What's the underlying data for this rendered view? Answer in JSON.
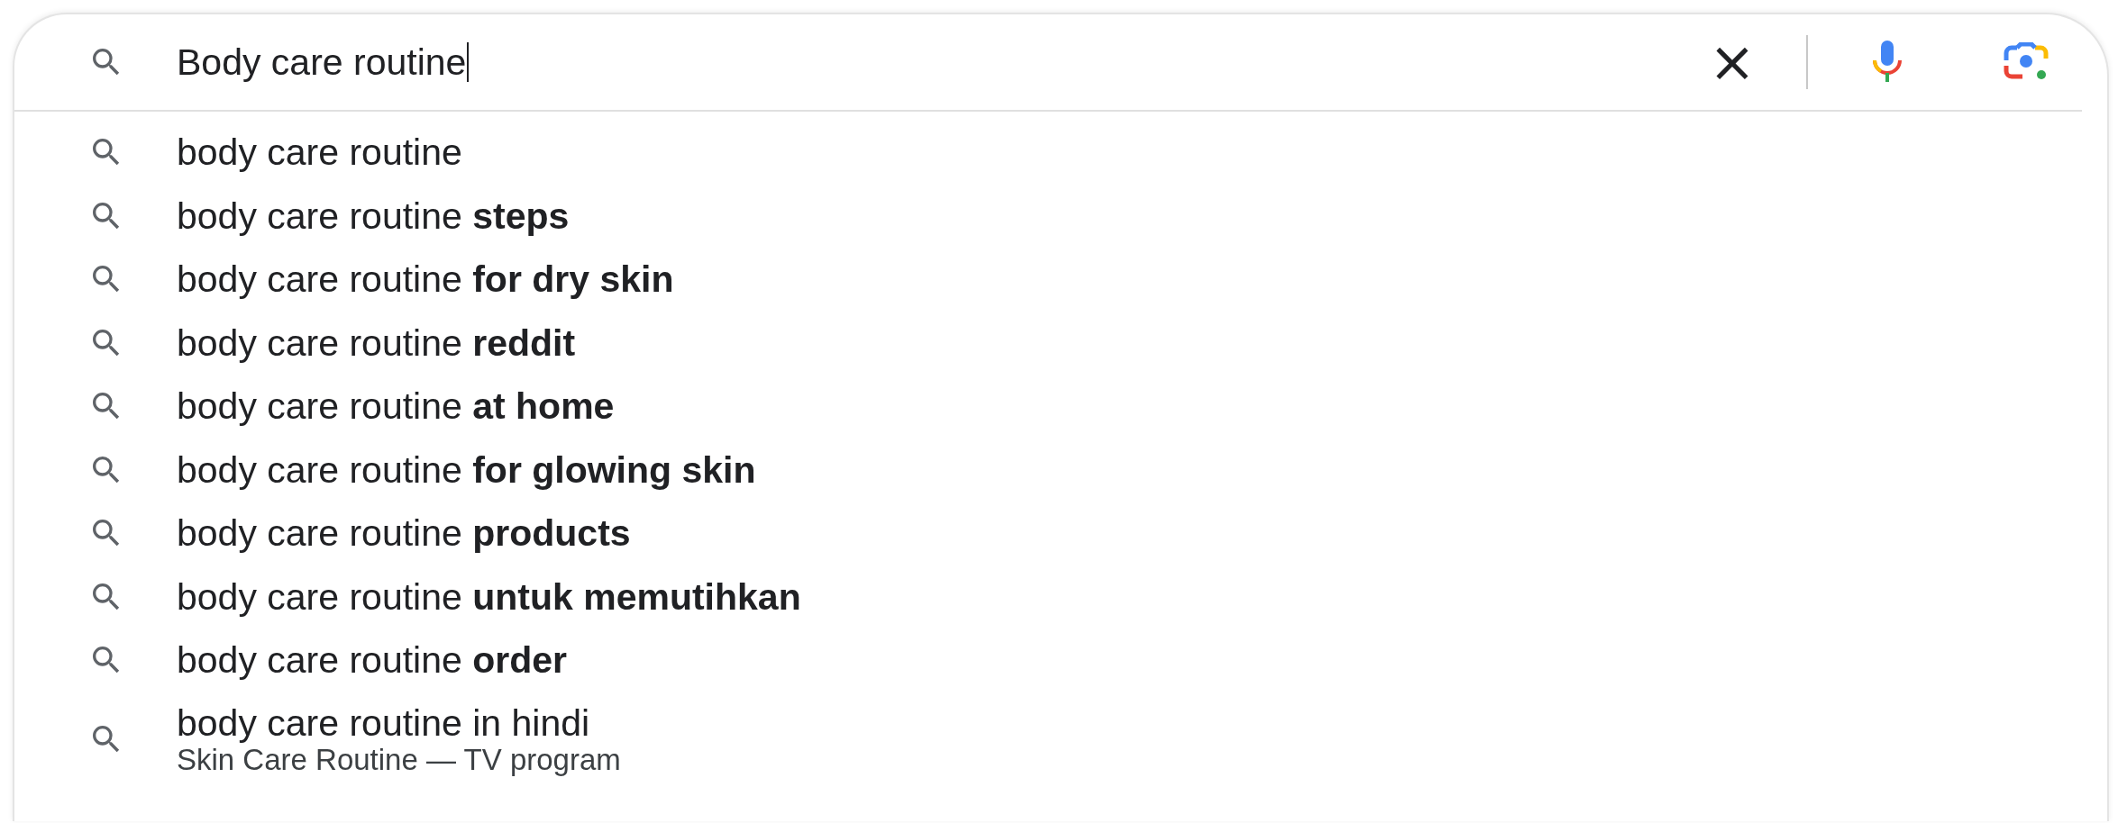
{
  "search": {
    "value": "Body care routine",
    "clear_label": "×"
  },
  "suggestions": [
    {
      "text": "body care routine"
    },
    {
      "text": "body care routine **steps**"
    },
    {
      "text": "body care routine **for dry skin**"
    },
    {
      "text": "body care routine **reddit**"
    },
    {
      "text": "body care routine **at home**"
    },
    {
      "text": "body care routine **for glowing skin**"
    },
    {
      "text": "body care routine **products**"
    },
    {
      "text": "body care routine **untuk memutihkan**"
    },
    {
      "text": "body care routine **order**"
    },
    {
      "text": "body care routine in hindi",
      "subtitle": "Skin Care Routine — TV program"
    }
  ]
}
